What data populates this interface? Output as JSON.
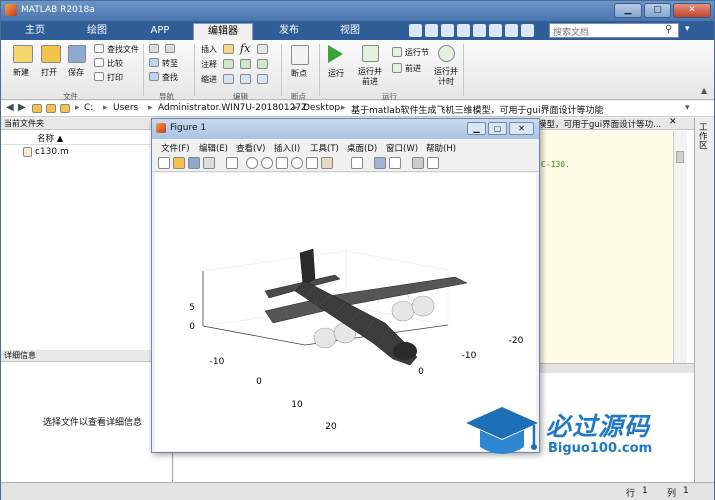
{
  "window": {
    "title": "MATLAB R2018a",
    "controls": [
      "▁",
      "▢",
      "✕"
    ]
  },
  "tabs": [
    "主页",
    "绘图",
    "APP",
    "编辑器",
    "发布",
    "视图"
  ],
  "active_tab": "编辑器",
  "search": {
    "placeholder": "搜索文档"
  },
  "ribbon": {
    "file": {
      "new": "新建",
      "open": "打开",
      "save": "保存",
      "find_files": "查找文件",
      "compare": "比较",
      "print": "打印",
      "group": "文件"
    },
    "nav": {
      "goto": "转至",
      "find": "查找",
      "group": "导航"
    },
    "edit": {
      "insert": "插入",
      "comment": "注释",
      "indent": "缩进",
      "group": "编辑"
    },
    "breakpoints": {
      "label": "断点",
      "group": "断点"
    },
    "run": {
      "run": "运行",
      "run_advance": "运行并\n前进",
      "run_section": "运行节",
      "advance": "前进",
      "run_time": "运行并\n计时",
      "group": "运行"
    }
  },
  "address": {
    "segments": [
      "C:",
      "Users",
      "Administrator.WIN7U-20180127Z",
      "Desktop",
      "基于matlab软件生成飞机三维模型，可用于gui界面设计等功能"
    ]
  },
  "current_folder": {
    "title": "当前文件夹",
    "col_name": "名称 ▲",
    "files": [
      "c130.m"
    ]
  },
  "details": {
    "title": "详细信息",
    "message": "选择文件以查看详细信息"
  },
  "editor": {
    "title_fragment": "模型，可用于gui界面设计等功...",
    "code_fragment": "C-130."
  },
  "right_panel": {
    "label": "工作区"
  },
  "status": {
    "row_label": "行",
    "row": "1",
    "col_label": "列",
    "col": "1"
  },
  "figure": {
    "title": "Figure 1",
    "menus": [
      "文件(F)",
      "编辑(E)",
      "查看(V)",
      "插入(I)",
      "工具(T)",
      "桌面(D)",
      "窗口(W)",
      "帮助(H)"
    ],
    "z_ticks": [
      "5",
      "0"
    ],
    "x_ticks": [
      "-10",
      "0",
      "10",
      "20"
    ],
    "y_ticks": [
      "-20",
      "-10",
      "0"
    ]
  },
  "watermark": {
    "cn": "必过源码",
    "en": "Biguo100.com"
  },
  "colors": {
    "tabbar": "#2f5d97",
    "titlebar": "#4a76ae",
    "editor_bg": "#fffde6",
    "plane": "#3a3a3a"
  }
}
